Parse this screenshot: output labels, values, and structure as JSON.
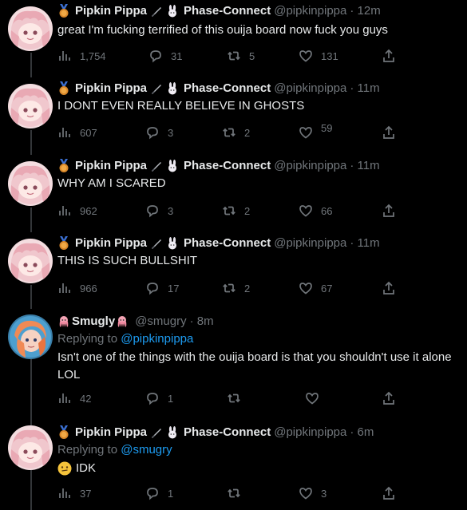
{
  "tweets": [
    {
      "display_name": "Pipkin Pippa",
      "affiliation": "Phase-Connect",
      "handle": "@pipkinpippa",
      "time": "· 12m",
      "text": "great I'm fucking terrified of this ouija board now fuck you guys",
      "views": "1,754",
      "replies": "31",
      "retweets": "5",
      "likes": "131"
    },
    {
      "display_name": "Pipkin Pippa",
      "affiliation": "Phase-Connect",
      "handle": "@pipkinpippa",
      "time": "· 11m",
      "text": "I DONT EVEN REALLY BELIEVE IN GHOSTS",
      "views": "607",
      "replies": "3",
      "retweets": "2",
      "likes": "59"
    },
    {
      "display_name": "Pipkin Pippa",
      "affiliation": "Phase-Connect",
      "handle": "@pipkinpippa",
      "time": "· 11m",
      "text": "WHY AM I SCARED",
      "views": "962",
      "replies": "3",
      "retweets": "2",
      "likes": "66"
    },
    {
      "display_name": "Pipkin Pippa",
      "affiliation": "Phase-Connect",
      "handle": "@pipkinpippa",
      "time": "· 11m",
      "text": "THIS IS SUCH BULLSHIT",
      "views": "966",
      "replies": "17",
      "retweets": "2",
      "likes": "67"
    },
    {
      "display_name": "Smugly",
      "handle": "@smugry",
      "time": "· 8m",
      "reply_prefix": "Replying to",
      "reply_mention": "@pipkinpippa",
      "text": "Isn't one of the things with the ouija board is that you shouldn't use it alone LOL",
      "views": "42",
      "replies": "1",
      "retweets": "",
      "likes": ""
    },
    {
      "display_name": "Pipkin Pippa",
      "affiliation": "Phase-Connect",
      "handle": "@pipkinpippa",
      "time": "· 6m",
      "reply_prefix": "Replying to",
      "reply_mention": "@smugry",
      "text": "IDK",
      "views": "37",
      "replies": "1",
      "retweets": "",
      "likes": "3"
    }
  ],
  "icons": {
    "views": "bar-chart-icon",
    "reply": "speech-bubble-icon",
    "retweet": "retweet-arrows-icon",
    "like": "heart-icon",
    "share": "share-upload-icon"
  },
  "colors": {
    "background": "#000000",
    "text": "#e7e9ea",
    "muted": "#71767b",
    "link": "#1d9bf0"
  }
}
